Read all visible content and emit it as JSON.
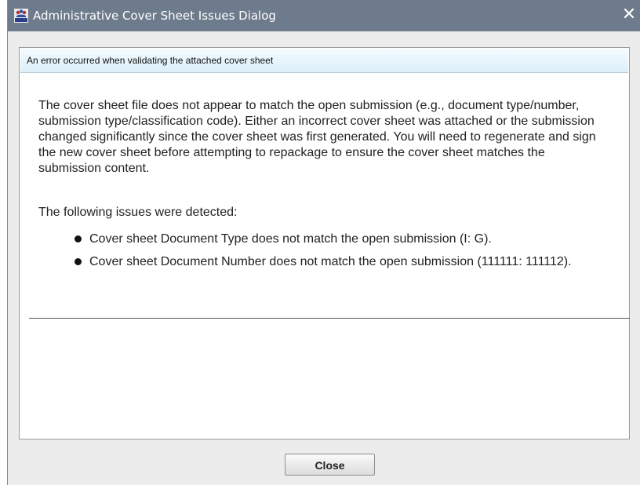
{
  "window": {
    "title": "Administrative Cover Sheet Issues Dialog",
    "app_icon": "cvm-app-icon",
    "close_glyph": "✕"
  },
  "header": {
    "text": "An error occurred when validating the attached cover sheet"
  },
  "message": {
    "body": "The cover sheet file does not appear to match the open submission (e.g., document type/number, submission type/classification code). Either an incorrect cover sheet was attached or the submission changed significantly since the cover sheet was first generated. You will need to regenerate and sign the new cover sheet before attempting to repackage to ensure the cover sheet matches the submission content.",
    "issues_title": "The following issues were detected:",
    "issues": [
      "Cover sheet Document Type does not match the open submission (I: G).",
      "Cover sheet Document Number does not match the open submission (111111: 111112)."
    ]
  },
  "buttons": {
    "close_label": "Close"
  },
  "colors": {
    "titlebar": "#6d7b8c",
    "header_banner": "#dceff8"
  },
  "icon_labels": {
    "app_icon_text": "CVM"
  }
}
